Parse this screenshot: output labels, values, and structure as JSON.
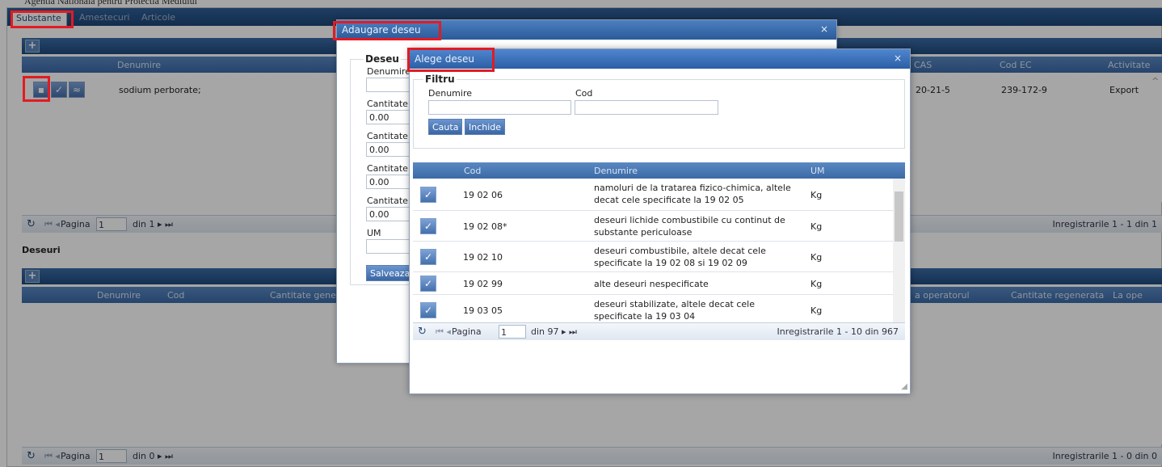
{
  "header": {
    "agency": "Agentia Nationala pentru Protectia Mediului"
  },
  "tabs": [
    {
      "label": "Substante",
      "active": true
    },
    {
      "label": "Amestecuri",
      "active": false
    },
    {
      "label": "Articole",
      "active": false
    }
  ],
  "substante": {
    "columns": {
      "denumire": "Denumire",
      "cas": "CAS",
      "cod_ec": "Cod EC",
      "activitate": "Activitate"
    },
    "row": {
      "denumire": "sodium perborate;",
      "cas": "20-21-5",
      "cod_ec": "239-172-9",
      "activitate": "Export"
    },
    "pager": {
      "page_label": "Pagina",
      "page_value": "1",
      "of": "din 1",
      "records": "Inregistrarile 1 - 1 din 1"
    }
  },
  "deseuri": {
    "title": "Deseuri",
    "columns": {
      "denumire": "Denumire",
      "cod": "Cod",
      "cantitate": "Cantitate gene",
      "operator": "a operatorul",
      "regenerata": "Cantitate regenerata",
      "la_ope": "La ope"
    },
    "pager": {
      "page_label": "Pagina",
      "page_value": "1",
      "of": "din 0",
      "records": "Inregistrarile 1 - 0 din 0"
    }
  },
  "adaugare": {
    "title": "Adaugare deseu",
    "legend": "Deseu",
    "fields": [
      {
        "label": "Denumire",
        "value": ""
      },
      {
        "label": "Cantitate",
        "value": "0.00"
      },
      {
        "label": "Cantitate",
        "value": "0.00"
      },
      {
        "label": "Cantitate",
        "value": "0.00"
      },
      {
        "label": "Cantitate",
        "value": "0.00"
      },
      {
        "label": "UM",
        "value": ""
      }
    ],
    "save": "Salveaza"
  },
  "alege": {
    "title": "Alege deseu",
    "filter": {
      "legend": "Filtru",
      "denumire_label": "Denumire",
      "cod_label": "Cod",
      "search": "Cauta",
      "close": "Inchide"
    },
    "columns": {
      "cod": "Cod",
      "denumire": "Denumire",
      "um": "UM"
    },
    "rows": [
      {
        "cod": "19 02 06",
        "denumire": "namoluri de la tratarea fizico-chimica, altele decat cele specificate la 19 02 05",
        "um": "Kg"
      },
      {
        "cod": "19 02 08*",
        "denumire": "deseuri lichide combustibile cu continut de substante periculoase",
        "um": "Kg"
      },
      {
        "cod": "19 02 10",
        "denumire": "deseuri combustibile, altele decat cele specificate la 19 02 08 si 19 02 09",
        "um": "Kg"
      },
      {
        "cod": "19 02 99",
        "denumire": "alte deseuri nespecificate",
        "um": "Kg"
      },
      {
        "cod": "19 03 05",
        "denumire": "deseuri stabilizate, altele decat cele specificate la 19 03 04",
        "um": "Kg"
      }
    ],
    "pager": {
      "page_label": "Pagina",
      "page_value": "1",
      "of": "din 97",
      "records": "Inregistrarile 1 - 10 din 967"
    }
  },
  "icons": {
    "close": "×",
    "plus": "+",
    "refresh": "↻",
    "select": "✓",
    "nav_prev": "◂",
    "nav_next": "▸",
    "nav_first": "⏮",
    "nav_last": "⏭",
    "scroll_up": "^",
    "scroll_down": "v"
  },
  "colors": {
    "header": "#2b5a98",
    "highlight": "#e21b23"
  }
}
